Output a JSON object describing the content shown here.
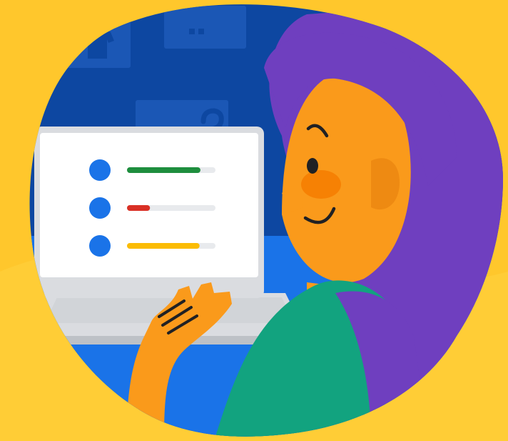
{
  "scene": {
    "subject": "person-using-laptop",
    "colors": {
      "background_yellow": "#FFC72C",
      "background_yellow_light": "#FFD23F",
      "wall_navy": "#0D47A1",
      "desk_blue": "#1A73E8",
      "frame_blue": "#1E5BB8",
      "laptop_frame": "#DADCE0",
      "laptop_screen": "#FFFFFF",
      "list_dot_blue": "#1A73E8",
      "bar_track": "#E8EAED",
      "bar_green": "#1E8E3E",
      "bar_red": "#D93025",
      "bar_yellow": "#FBBC04",
      "skin": "#FA9A1B",
      "skin_shadow": "#EE8A12",
      "cheek": "#F57C00",
      "hair": "#6F3FBF",
      "shirt": "#12A37F",
      "ink": "#202124"
    },
    "screen_list": [
      {
        "icon": "circle-icon",
        "bar_color": "green",
        "progress": 0.83
      },
      {
        "icon": "circle-icon",
        "bar_color": "red",
        "progress": 0.26
      },
      {
        "icon": "circle-icon",
        "bar_color": "yellow",
        "progress": 0.82
      }
    ],
    "wall_frames": [
      {
        "icon": "shirt-icon"
      },
      {
        "icon": "briefcase-icon"
      },
      {
        "icon": "question-mark-icon"
      }
    ]
  }
}
